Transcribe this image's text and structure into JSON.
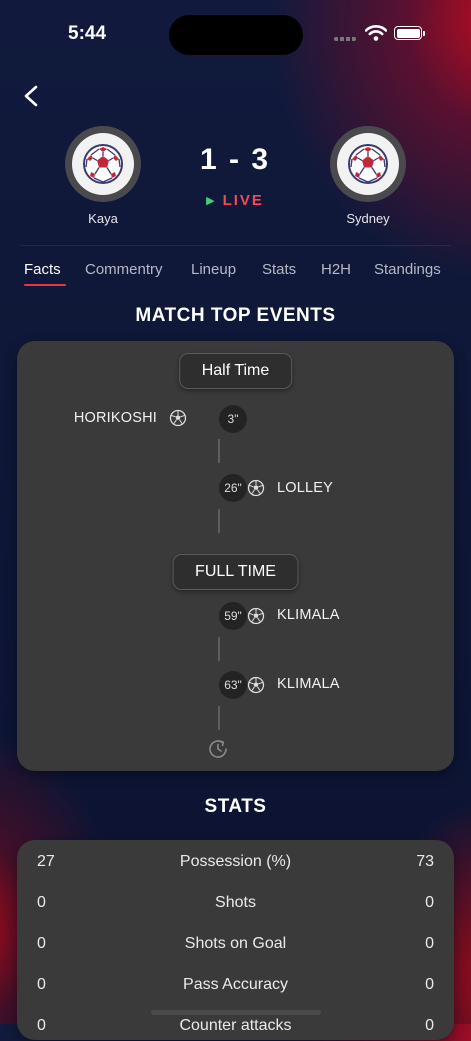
{
  "status_bar": {
    "time": "5:44"
  },
  "match": {
    "home_team": "Kaya",
    "away_team": "Sydney",
    "score": "1 - 3",
    "status": "LIVE"
  },
  "tabs": [
    "Facts",
    "Commentry",
    "Lineup",
    "Stats",
    "H2H",
    "Standings"
  ],
  "active_tab": "Facts",
  "events": {
    "title": "MATCH TOP EVENTS",
    "half_time_label": "Half Time",
    "full_time_label": "FULL TIME",
    "items": [
      {
        "minute": "3\"",
        "player": "HORIKOSHI",
        "side": "home",
        "icon": "soccer-ball-icon"
      },
      {
        "minute": "26\"",
        "player": "LOLLEY",
        "side": "away",
        "icon": "soccer-ball-icon"
      },
      {
        "minute": "59\"",
        "player": "KLIMALA",
        "side": "away",
        "icon": "soccer-ball-icon"
      },
      {
        "minute": "63\"",
        "player": "KLIMALA",
        "side": "away",
        "icon": "soccer-ball-icon"
      }
    ],
    "end_icon": "clock-refresh-icon"
  },
  "stats": {
    "title": "STATS",
    "rows": [
      {
        "home": "27",
        "name": "Possession (%)",
        "away": "73"
      },
      {
        "home": "0",
        "name": "Shots",
        "away": "0"
      },
      {
        "home": "0",
        "name": "Shots on Goal",
        "away": "0"
      },
      {
        "home": "0",
        "name": "Pass Accuracy",
        "away": "0"
      },
      {
        "home": "0",
        "name": "Counter attacks",
        "away": "0"
      }
    ]
  },
  "colors": {
    "accent": "#e63646",
    "live": "#f04b56",
    "live_play": "#3fd17a",
    "card": "#3a3a3a"
  }
}
